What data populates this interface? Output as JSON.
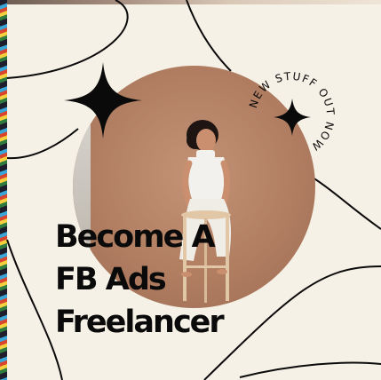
{
  "poster": {
    "headline_lines": [
      "Become A",
      "FB Ads",
      "Freelancer"
    ],
    "badge_text": "NEW STUFF OUT NOW"
  },
  "colors": {
    "background": "#f6f1e6",
    "photo_bg": "#b17e62",
    "ink": "#0a0a0a"
  },
  "icons": {
    "big_sparkle": "four-point-star-icon",
    "small_sparkle": "four-point-star-icon"
  }
}
